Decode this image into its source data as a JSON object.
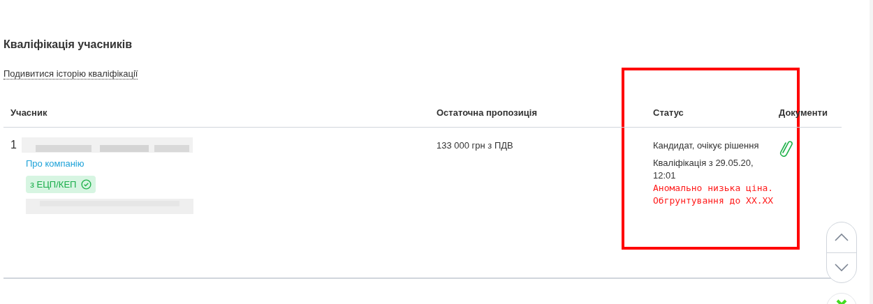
{
  "section": {
    "title": "Кваліфікація учасників",
    "history_link": "Подивитися історію кваліфікації"
  },
  "table": {
    "columns": [
      "Учасник",
      "Остаточна пропозиція",
      "Статус",
      "Документи"
    ],
    "rows": [
      {
        "number": "1",
        "company_link": "Про компанію",
        "signature_badge": "з ЕЦП/КЕП",
        "offer": "133 000 грн з ПДВ",
        "status": "Кандидат, очікує рішення",
        "qualification": "Кваліфікація з 29.05.20, 12:01",
        "note": "Аномально низька ціна. Обгрунтування до XX.XX"
      }
    ]
  }
}
